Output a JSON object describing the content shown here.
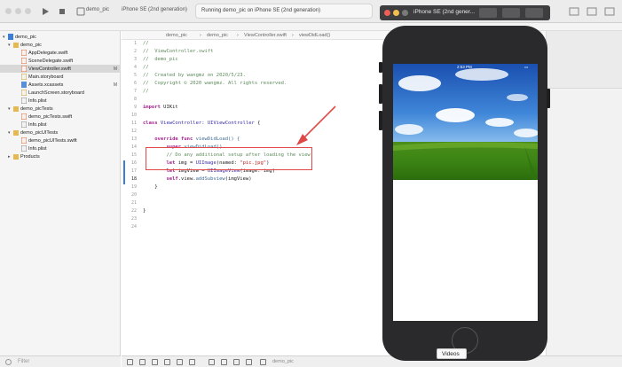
{
  "toolbar": {
    "scheme": "demo_pic",
    "device": "iPhone SE (2nd generation)",
    "status": "Running demo_pic on iPhone SE (2nd generation)"
  },
  "simulator": {
    "title": "iPhone SE (2nd gener...",
    "time": "2:53 PM",
    "tooltip": "Videos"
  },
  "navigator": {
    "items": [
      {
        "label": "demo_pic",
        "badge": ""
      },
      {
        "label": "demo_pic",
        "badge": ""
      },
      {
        "label": "AppDelegate.swift",
        "badge": ""
      },
      {
        "label": "SceneDelegate.swift",
        "badge": ""
      },
      {
        "label": "ViewController.swift",
        "badge": "M"
      },
      {
        "label": "Main.storyboard",
        "badge": ""
      },
      {
        "label": "Assets.xcassets",
        "badge": "M"
      },
      {
        "label": "LaunchScreen.storyboard",
        "badge": ""
      },
      {
        "label": "Info.plist",
        "badge": ""
      },
      {
        "label": "demo_picTests",
        "badge": ""
      },
      {
        "label": "demo_picTests.swift",
        "badge": ""
      },
      {
        "label": "Info.plist",
        "badge": ""
      },
      {
        "label": "demo_picUITests",
        "badge": ""
      },
      {
        "label": "demo_picUITests.swift",
        "badge": ""
      },
      {
        "label": "Info.plist",
        "badge": ""
      },
      {
        "label": "Products",
        "badge": ""
      }
    ],
    "filter_placeholder": "Filter"
  },
  "jumpbar": {
    "project": "demo_pic",
    "group": "demo_pic",
    "file": "ViewController.swift",
    "symbol": "viewDidLoad()"
  },
  "editor": {
    "line_numbers": [
      "1",
      "2",
      "3",
      "4",
      "5",
      "6",
      "7",
      "8",
      "9",
      "10",
      "11",
      "12",
      "13",
      "14",
      "15",
      "16",
      "17",
      "18",
      "19",
      "20",
      "21",
      "22",
      "23",
      "24"
    ],
    "l1": "//",
    "l2": "//  ViewController.swift",
    "l3": "//  demo_pic",
    "l4": "//",
    "l5": "//  Created by wangmz on 2020/5/23.",
    "l6": "//  Copyright © 2020 wangmz. All rights reserved.",
    "l7": "//",
    "l9_kw": "import",
    "l9_rest": " UIKit",
    "l11_kw": "class",
    "l11_name": " ViewController: ",
    "l11_type": "UIViewController",
    "l11_end": " {",
    "l13_kw": "    override func",
    "l13_name": " viewDidLoad() {",
    "l14_kw": "        super",
    "l14_call": ".viewDidLoad()",
    "l15": "        // Do any additional setup after loading the view.",
    "l16_kw": "        let",
    "l16_a": " img = ",
    "l16_type": "UIImage",
    "l16_b": "(named: ",
    "l16_str": "\"pic.jpg\"",
    "l16_c": ")",
    "l17_kw": "        let",
    "l17_a": " imgView = ",
    "l17_type": "UIImageView",
    "l17_b": "(image: img)",
    "l18_kw": "        self",
    "l18_a": ".view.",
    "l18_call": "addSubview",
    "l18_b": "(imgView)",
    "l19": "    }",
    "l22": "}"
  },
  "debugbar": {
    "target": "demo_pic"
  },
  "colors": {
    "accent": "#3b7dd8",
    "highlight": "#e04848"
  }
}
